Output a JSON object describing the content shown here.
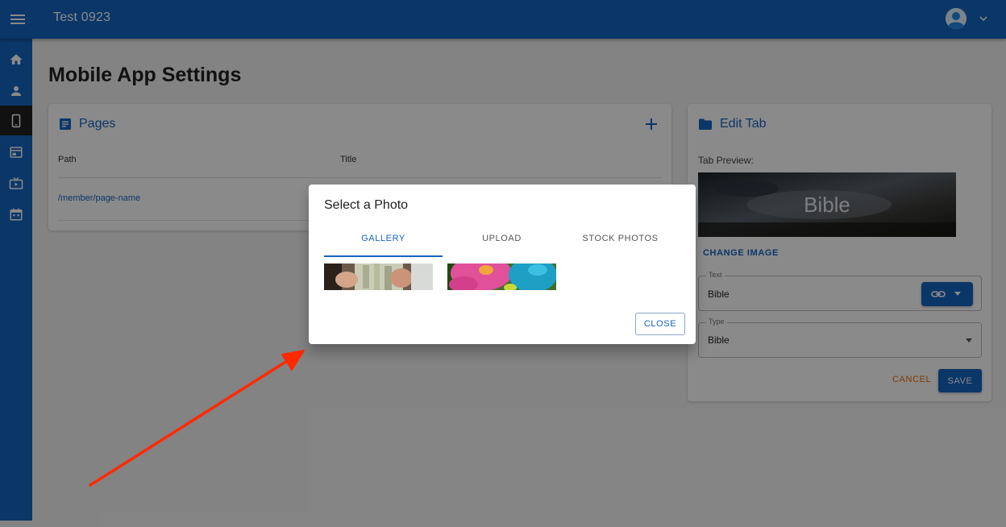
{
  "app": {
    "title": "Test 0923"
  },
  "nav": {
    "items": [
      {
        "name": "home",
        "icon": "home-icon",
        "active": false
      },
      {
        "name": "members",
        "icon": "person-icon",
        "active": false
      },
      {
        "name": "mobile",
        "icon": "phone-icon",
        "active": true
      },
      {
        "name": "website",
        "icon": "web-icon",
        "active": false
      },
      {
        "name": "streaming",
        "icon": "tv-icon",
        "active": false
      },
      {
        "name": "calendar",
        "icon": "calendar-icon",
        "active": false
      }
    ]
  },
  "page": {
    "title": "Mobile App Settings"
  },
  "pages_card": {
    "title": "Pages",
    "columns": {
      "path": "Path",
      "title": "Title"
    },
    "rows": [
      {
        "path": "/member/page-name",
        "title": ""
      }
    ]
  },
  "edit_tab": {
    "title": "Edit Tab",
    "preview_label": "Tab Preview:",
    "preview_text": "Bible",
    "change_image_label": "CHANGE IMAGE",
    "text_field": {
      "label": "Text",
      "value": "Bible"
    },
    "type_field": {
      "label": "Type",
      "value": "Bible"
    },
    "cancel_label": "CANCEL",
    "save_label": "SAVE"
  },
  "dialog": {
    "title": "Select a Photo",
    "tabs": [
      {
        "label": "GALLERY",
        "active": true
      },
      {
        "label": "UPLOAD",
        "active": false
      },
      {
        "label": "STOCK PHOTOS",
        "active": false
      }
    ],
    "close_label": "CLOSE"
  },
  "colors": {
    "primary": "#1565c0",
    "cancel": "#ef6c00",
    "arrow": "#ff2a00",
    "active_nav": "#212121"
  }
}
